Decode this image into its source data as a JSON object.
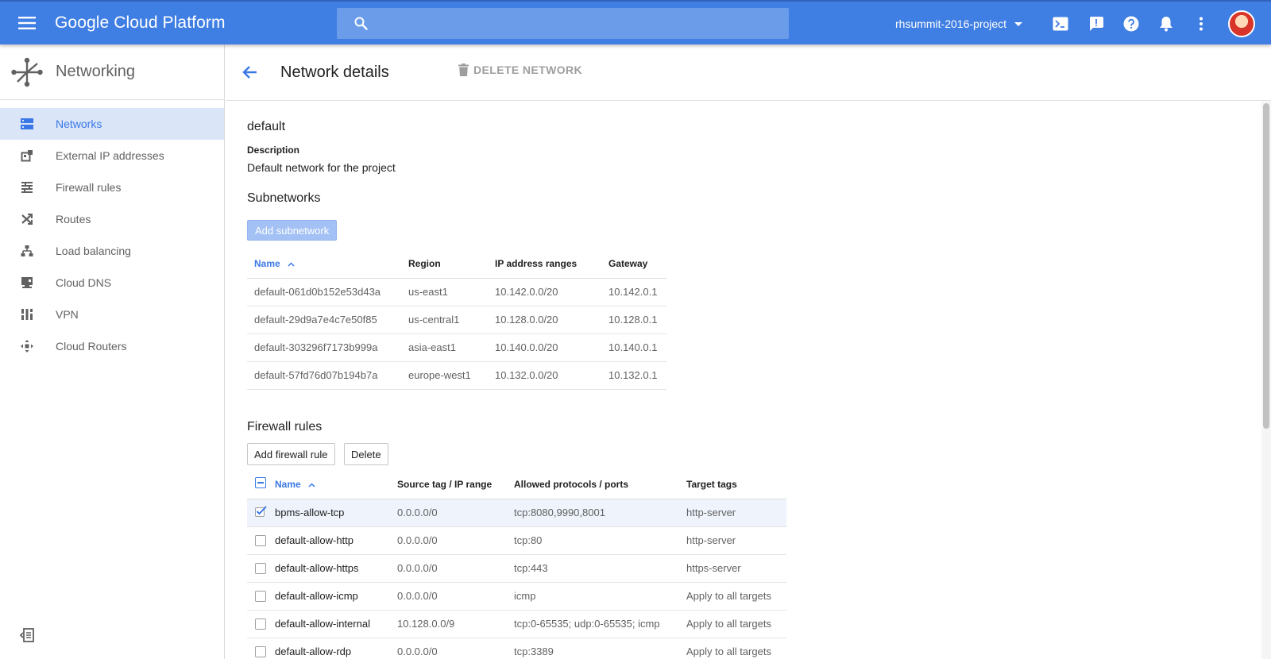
{
  "topbar": {
    "brand": "Google Cloud Platform",
    "search_placeholder": "",
    "project": "rhsummit-2016-project"
  },
  "sidebar": {
    "title": "Networking",
    "items": [
      {
        "label": "Networks",
        "icon": "networks-icon",
        "active": true
      },
      {
        "label": "External IP addresses",
        "icon": "external-ip-icon"
      },
      {
        "label": "Firewall rules",
        "icon": "firewall-icon"
      },
      {
        "label": "Routes",
        "icon": "routes-icon"
      },
      {
        "label": "Load balancing",
        "icon": "load-balancing-icon"
      },
      {
        "label": "Cloud DNS",
        "icon": "cloud-dns-icon"
      },
      {
        "label": "VPN",
        "icon": "vpn-icon"
      },
      {
        "label": "Cloud Routers",
        "icon": "cloud-routers-icon"
      }
    ]
  },
  "header": {
    "title": "Network details",
    "delete_label": "DELETE NETWORK"
  },
  "network": {
    "name": "default",
    "description_label": "Description",
    "description": "Default network for the project"
  },
  "subnetworks": {
    "title": "Subnetworks",
    "add_label": "Add subnetwork",
    "columns": [
      "Name",
      "Region",
      "IP address ranges",
      "Gateway"
    ],
    "rows": [
      [
        "default-061d0b152e53d43a",
        "us-east1",
        "10.142.0.0/20",
        "10.142.0.1"
      ],
      [
        "default-29d9a7e4c7e50f85",
        "us-central1",
        "10.128.0.0/20",
        "10.128.0.1"
      ],
      [
        "default-303296f7173b999a",
        "asia-east1",
        "10.140.0.0/20",
        "10.140.0.1"
      ],
      [
        "default-57fd76d07b194b7a",
        "europe-west1",
        "10.132.0.0/20",
        "10.132.0.1"
      ]
    ]
  },
  "firewall": {
    "title": "Firewall rules",
    "add_label": "Add firewall rule",
    "delete_label": "Delete",
    "columns": [
      "Name",
      "Source tag / IP range",
      "Allowed protocols / ports",
      "Target tags"
    ],
    "rows": [
      [
        "bpms-allow-tcp",
        "0.0.0.0/0",
        "tcp:8080,9990,8001",
        "http-server"
      ],
      [
        "default-allow-http",
        "0.0.0.0/0",
        "tcp:80",
        "http-server"
      ],
      [
        "default-allow-https",
        "0.0.0.0/0",
        "tcp:443",
        "https-server"
      ],
      [
        "default-allow-icmp",
        "0.0.0.0/0",
        "icmp",
        "Apply to all targets"
      ],
      [
        "default-allow-internal",
        "10.128.0.0/9",
        "tcp:0-65535; udp:0-65535; icmp",
        "Apply to all targets"
      ],
      [
        "default-allow-rdp",
        "0.0.0.0/0",
        "tcp:3389",
        "Apply to all targets"
      ]
    ],
    "checked": [
      true,
      false,
      false,
      false,
      false,
      false
    ]
  },
  "colors": {
    "topbar": "#3f7ee3",
    "accent": "#3b78e7",
    "active_nav_bg": "#dae5f8"
  }
}
